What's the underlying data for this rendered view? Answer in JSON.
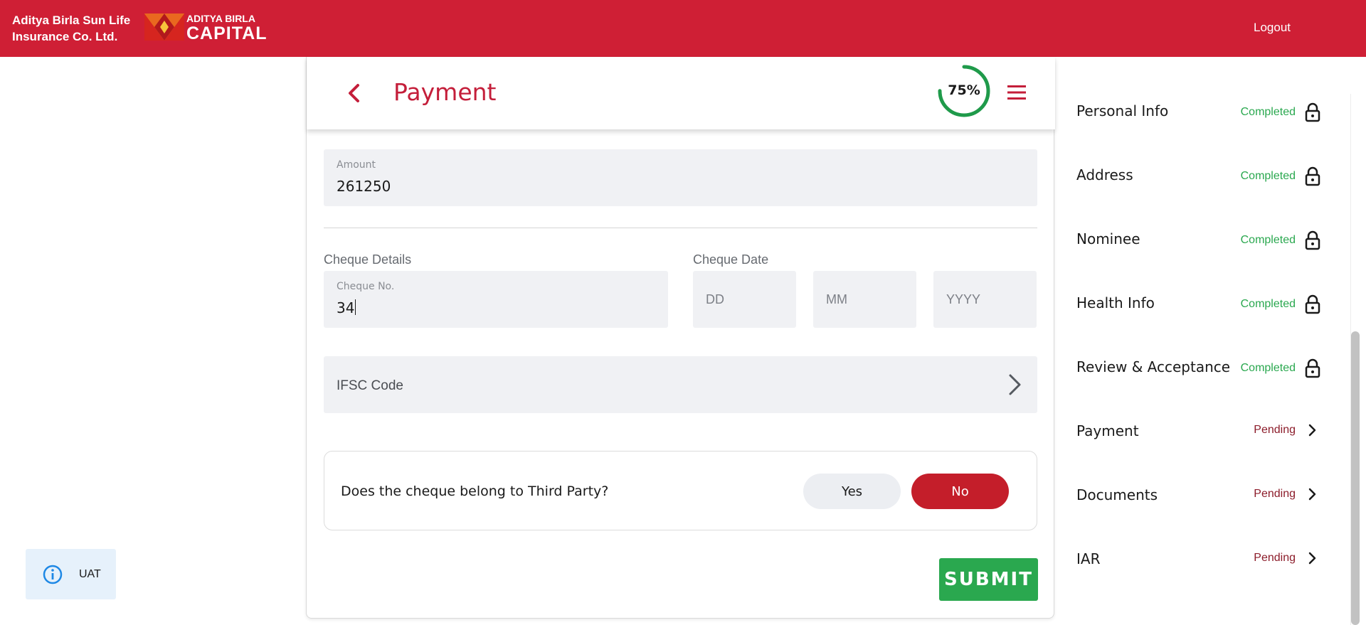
{
  "header": {
    "brand_line1": "Aditya Birla Sun Life",
    "brand_line2": "Insurance Co. Ltd.",
    "logo_line1": "ADITYA BIRLA",
    "logo_line2": "CAPITAL",
    "logout_label": "Logout",
    "color": "#cf1f35"
  },
  "page": {
    "title": "Payment",
    "progress_label": "75%",
    "progress_value": 0.75,
    "accent_color": "#c41e3a"
  },
  "amount": {
    "label": "Amount",
    "value": "261250"
  },
  "cheque": {
    "section_label": "Cheque Details",
    "number_label": "Cheque No.",
    "number_value": "34",
    "date_section_label": "Cheque Date",
    "date_day_placeholder": "DD",
    "date_month_placeholder": "MM",
    "date_year_placeholder": "YYYY"
  },
  "ifsc": {
    "label": "IFSC Code"
  },
  "third_party": {
    "question": "Does the cheque belong to Third Party?",
    "yes_label": "Yes",
    "no_label": "No",
    "selected": "No"
  },
  "submit_label": "SUBMIT",
  "sidebar": {
    "steps": [
      {
        "name": "Personal Info",
        "status": "Completed",
        "icon": "lock-icon"
      },
      {
        "name": "Address",
        "status": "Completed",
        "icon": "lock-icon"
      },
      {
        "name": "Nominee",
        "status": "Completed",
        "icon": "lock-icon"
      },
      {
        "name": "Health Info",
        "status": "Completed",
        "icon": "lock-icon"
      },
      {
        "name": "Review & Acceptance",
        "status": "Completed",
        "icon": "lock-icon"
      },
      {
        "name": "Payment",
        "status": "Pending",
        "icon": "chevron-right-icon"
      },
      {
        "name": "Documents",
        "status": "Pending",
        "icon": "chevron-right-icon"
      },
      {
        "name": "IAR",
        "status": "Pending",
        "icon": "chevron-right-icon"
      }
    ]
  },
  "env_badge": {
    "label": "UAT",
    "icon": "info-icon"
  }
}
